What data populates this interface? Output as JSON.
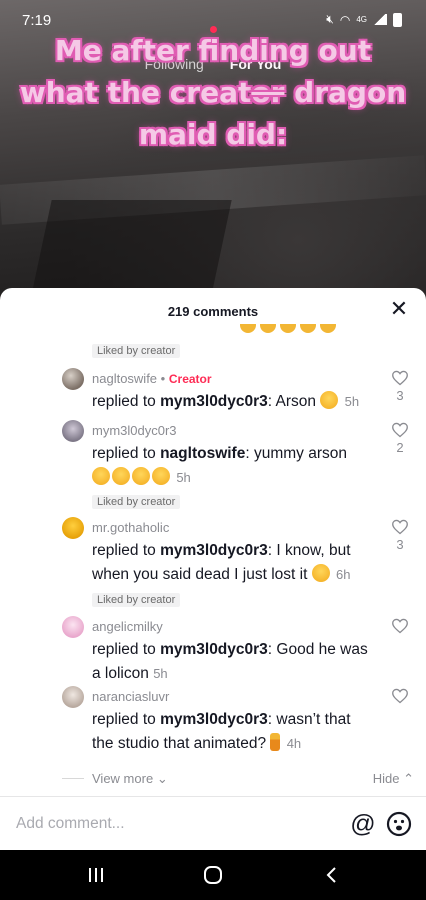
{
  "status_bar": {
    "time": "7:19",
    "network": "4G"
  },
  "video_feed": {
    "tabs": [
      {
        "label": "Following",
        "active": false
      },
      {
        "label": "For You",
        "active": true
      }
    ],
    "caption": {
      "line1": "Me after finding out",
      "line2_start": "what the creat",
      "line2_struck": "or",
      "line2_end": " dragon",
      "line3": "maid did:"
    }
  },
  "comments_panel": {
    "title": "219 comments",
    "liked_by_creator_label": "Liked by creator",
    "comments": [
      {
        "username": "nagltoswife",
        "badge": "Creator",
        "reply_prefix": "replied to ",
        "reply_to": "mym3l0dyc0r3",
        "text": ": Arson",
        "emojis": [
          "smiling-face-with-hearts"
        ],
        "time": "5h",
        "likes": "3"
      },
      {
        "username": "mym3l0dyc0r3",
        "reply_prefix": "replied to ",
        "reply_to": "nagltoswife",
        "text": ": yummy arson",
        "emojis": [
          "heart-eyes",
          "heart-eyes",
          "yum",
          "yum"
        ],
        "time": "5h",
        "likes": "2",
        "liked_by_creator": true
      },
      {
        "username": "mr.gothaholic",
        "reply_prefix": "replied to ",
        "reply_to": "mym3l0dyc0r3",
        "text": ": I know, but when you said dead I just lost it",
        "emojis": [
          "tired-face"
        ],
        "time": "6h",
        "likes": "3",
        "liked_by_creator": true
      },
      {
        "username": "angelicmilky",
        "reply_prefix": "replied to ",
        "reply_to": "mym3l0dyc0r3",
        "text": ": Good he was a lolicon",
        "time": "5h",
        "likes": ""
      },
      {
        "username": "naranciasluvr",
        "reply_prefix": "replied to ",
        "reply_to": "mym3l0dyc0r3",
        "text": ": wasn’t that the studio that animated?",
        "emojis": [
          "person-standing"
        ],
        "time": "4h",
        "likes": ""
      }
    ],
    "view_more": "View more",
    "hide": "Hide"
  },
  "composer": {
    "placeholder": "Add comment..."
  },
  "colors": {
    "accent": "#fe2c55",
    "caption_fill": "#f5c9e6",
    "caption_stroke": "#e05cb3"
  }
}
